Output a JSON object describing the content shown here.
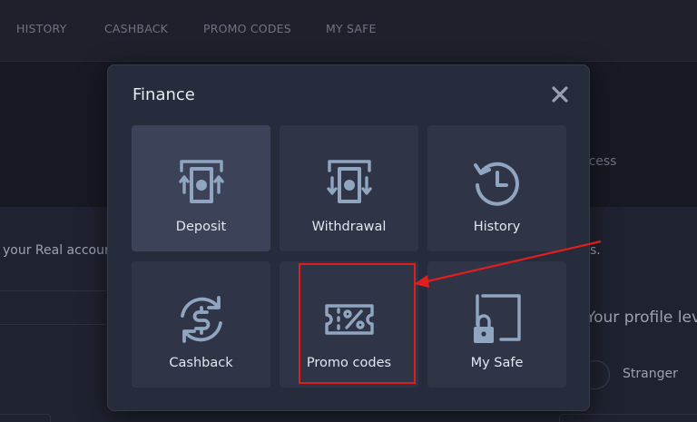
{
  "nav": {
    "items": [
      "HISTORY",
      "CASHBACK",
      "PROMO CODES",
      "MY SAFE"
    ]
  },
  "background": {
    "process_text": "ocess",
    "real_account_text": "your Real account",
    "dot_text": "s.",
    "profile_text": "Your profile leve",
    "stranger_text": "Stranger"
  },
  "modal": {
    "title": "Finance",
    "tiles": [
      {
        "label": "Deposit",
        "icon": "deposit-icon",
        "active": true
      },
      {
        "label": "Withdrawal",
        "icon": "withdrawal-icon",
        "active": false
      },
      {
        "label": "History",
        "icon": "history-icon",
        "active": false
      },
      {
        "label": "Cashback",
        "icon": "cashback-icon",
        "active": false
      },
      {
        "label": "Promo codes",
        "icon": "promo-codes-icon",
        "active": false
      },
      {
        "label": "My Safe",
        "icon": "my-safe-icon",
        "active": false
      }
    ]
  },
  "colors": {
    "icon": "#8fa5c0",
    "highlight": "#e01e1e",
    "modal_bg": "#272c3c",
    "tile_bg": "#2f3446",
    "tile_active_bg": "#3c4358"
  }
}
